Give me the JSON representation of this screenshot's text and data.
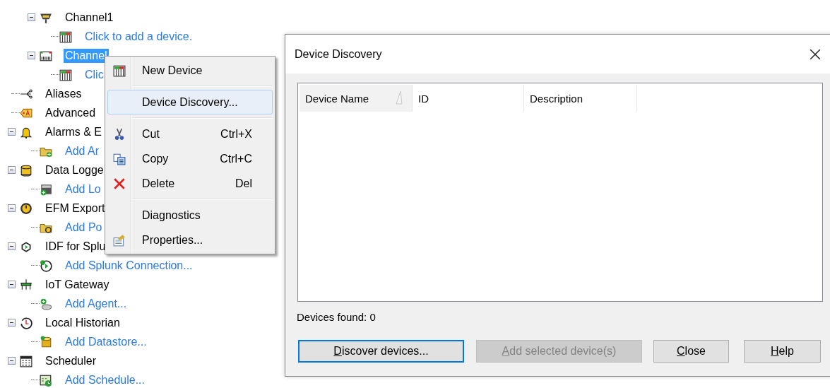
{
  "tree": {
    "continued_children": [
      {
        "label": "Channel1",
        "kind": "node",
        "expanded": true,
        "selected": false,
        "children": [
          {
            "label": "Click to add a device.",
            "kind": "action",
            "selected": false
          }
        ]
      },
      {
        "label": "Channel",
        "kind": "node",
        "expanded": true,
        "selected": true,
        "children": [
          {
            "label": "Clic",
            "kind": "action",
            "selected": false
          }
        ]
      }
    ],
    "items": [
      {
        "label": "Aliases",
        "kind": "node",
        "selected": false
      },
      {
        "label": "Advanced",
        "kind": "node",
        "selected": false
      },
      {
        "label": "Alarms & E",
        "kind": "node",
        "expanded": true,
        "selected": false,
        "children": [
          {
            "label": "Add Ar",
            "kind": "action",
            "selected": false
          }
        ]
      },
      {
        "label": "Data Logge",
        "kind": "node",
        "expanded": true,
        "selected": false,
        "children": [
          {
            "label": "Add Lo",
            "kind": "action",
            "selected": false
          }
        ]
      },
      {
        "label": "EFM Export",
        "kind": "node",
        "expanded": true,
        "selected": false,
        "children": [
          {
            "label": "Add Po",
            "kind": "action",
            "selected": false
          }
        ]
      },
      {
        "label": "IDF for Splu",
        "kind": "node",
        "expanded": true,
        "selected": false,
        "children": [
          {
            "label": "Add Splunk Connection...",
            "kind": "action",
            "selected": false
          }
        ]
      },
      {
        "label": "IoT Gateway",
        "kind": "node",
        "expanded": true,
        "selected": false,
        "children": [
          {
            "label": "Add Agent...",
            "kind": "action",
            "selected": false
          }
        ]
      },
      {
        "label": "Local Historian",
        "kind": "node",
        "expanded": true,
        "selected": false,
        "children": [
          {
            "label": "Add Datastore...",
            "kind": "action",
            "selected": false
          }
        ]
      },
      {
        "label": "Scheduler",
        "kind": "node",
        "expanded": true,
        "selected": false,
        "children": [
          {
            "label": "Add Schedule...",
            "kind": "action",
            "selected": false
          }
        ]
      }
    ]
  },
  "context_menu": {
    "items": [
      {
        "kind": "item",
        "label": "New Device",
        "selected": false
      },
      {
        "kind": "separator"
      },
      {
        "kind": "item",
        "label": "Device Discovery...",
        "selected": true
      },
      {
        "kind": "separator"
      },
      {
        "kind": "item",
        "label": "Cut",
        "shortcut": "Ctrl+X",
        "selected": false
      },
      {
        "kind": "item",
        "label": "Copy",
        "shortcut": "Ctrl+C",
        "selected": false
      },
      {
        "kind": "item",
        "label": "Delete",
        "shortcut": "Del",
        "selected": false
      },
      {
        "kind": "separator"
      },
      {
        "kind": "item",
        "label": "Diagnostics",
        "selected": false
      },
      {
        "kind": "item",
        "label": "Properties...",
        "selected": false
      }
    ]
  },
  "dialog": {
    "title": "Device Discovery",
    "columns": [
      {
        "label": "Device Name",
        "sorted": true
      },
      {
        "label": "ID",
        "sorted": false
      },
      {
        "label": "Description",
        "sorted": false
      }
    ],
    "status": "Devices found: 0",
    "buttons": [
      {
        "access_key": "D",
        "label_after_key": "iscover devices...",
        "default": true,
        "disabled": false
      },
      {
        "access_key": "A",
        "label_after_key": "dd selected device(s)",
        "default": false,
        "disabled": true
      },
      {
        "access_key": "C",
        "label_after_key": "lose",
        "default": false,
        "disabled": false
      },
      {
        "access_key": "H",
        "label_after_key": "elp",
        "default": false,
        "disabled": false
      }
    ]
  }
}
